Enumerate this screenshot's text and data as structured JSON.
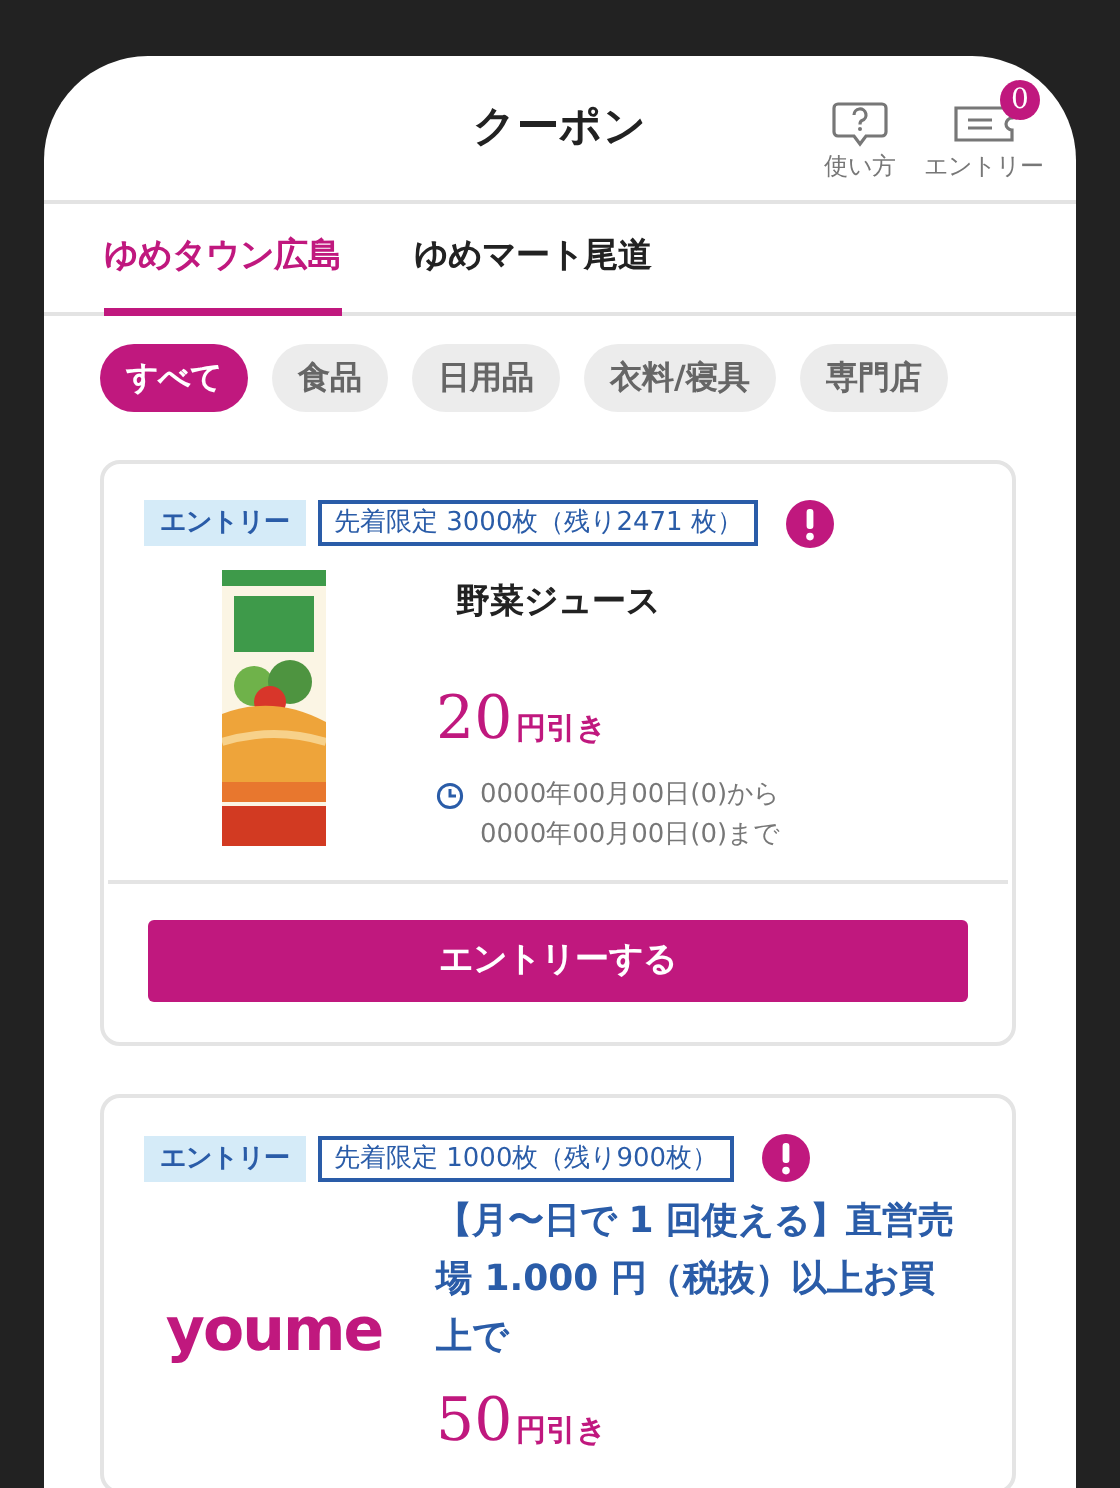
{
  "header": {
    "title": "クーポン",
    "actions": [
      {
        "kind": "help",
        "label": "使い方"
      },
      {
        "kind": "ticket",
        "label": "エントリー",
        "badge": "0"
      }
    ]
  },
  "stores": [
    {
      "label": "ゆめタウン広島",
      "selected": true
    },
    {
      "label": "ゆめマート尾道",
      "selected": false
    }
  ],
  "categories": [
    {
      "label": "すべて",
      "selected": true
    },
    {
      "label": "食品",
      "selected": false
    },
    {
      "label": "日用品",
      "selected": false
    },
    {
      "label": "衣料/寝具",
      "selected": false
    },
    {
      "label": "専門店",
      "selected": false
    }
  ],
  "coupons": [
    {
      "tag": "エントリー",
      "limit": "先着限定 3000枚（残り2471 枚）",
      "image": {
        "kind": "carton"
      },
      "title": "野菜ジュース",
      "kind": "product",
      "amount": "20",
      "unit": "円引き",
      "period": [
        "0000年00月00日(0)から",
        "0000年00月00日(0)まで"
      ],
      "button": "エントリーする"
    },
    {
      "tag": "エントリー",
      "limit": "先着限定 1000枚（残り900枚）",
      "image": {
        "kind": "logo",
        "text": "youme"
      },
      "title": "【月〜日で 1 回使える】直営売場 1.000 円（税抜）以上お買上で",
      "kind": "condition",
      "amount": "50",
      "unit": "円引き"
    }
  ]
}
